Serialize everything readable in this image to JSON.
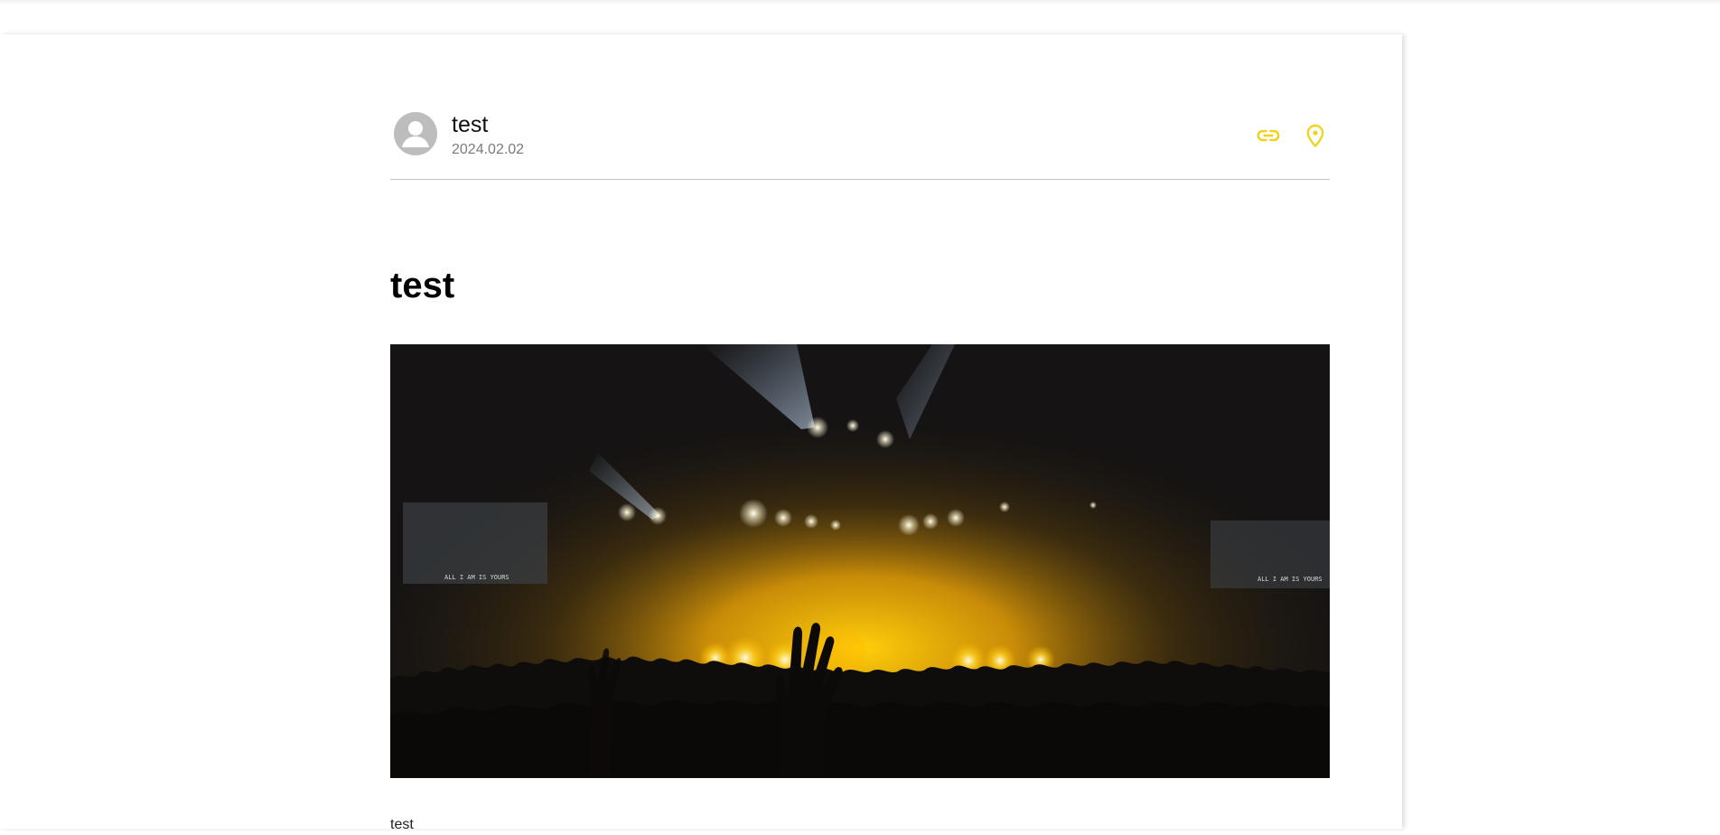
{
  "post": {
    "author": "test",
    "date": "2024.02.02",
    "title": "test",
    "body": "test"
  },
  "actions": {
    "link_icon": "link-icon",
    "location_icon": "map-pin-icon"
  },
  "image": {
    "stage_text_left": "ALL I AM IS YOURS",
    "stage_text_right": "ALL I AM IS YOURS"
  },
  "colors": {
    "accent": "#f2d21b",
    "divider": "#c4c4c4",
    "avatar": "#bdbdbd"
  }
}
